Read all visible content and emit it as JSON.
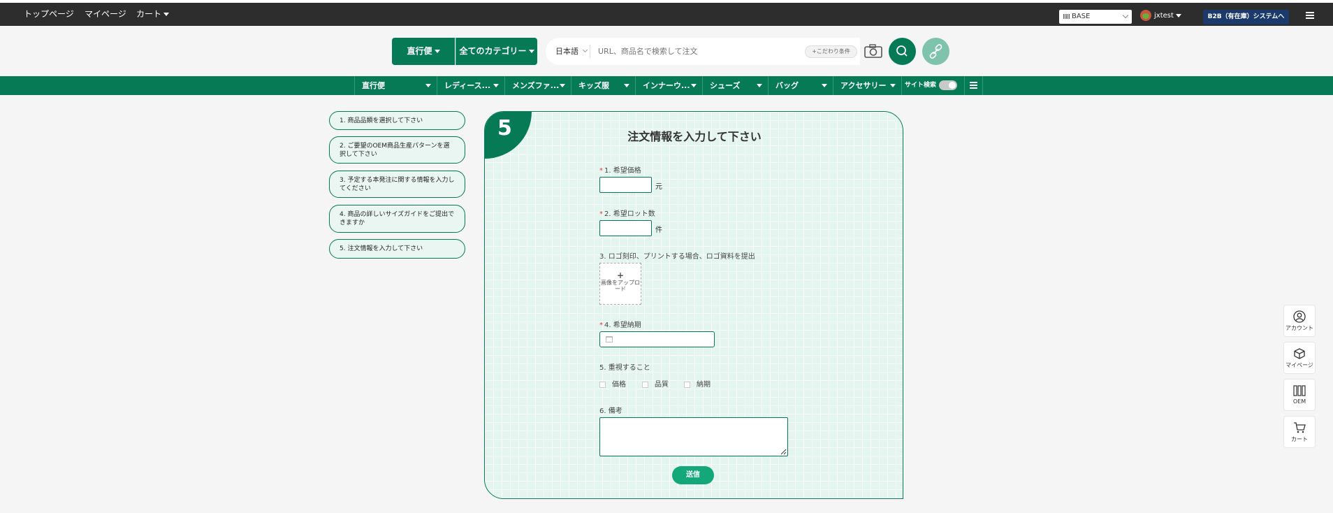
{
  "topbar": {
    "nav_home": "トップページ",
    "nav_mypage": "マイページ",
    "nav_cart": "カート",
    "base_select": "BASE",
    "username": "jxtest",
    "b2b_button": "B2B（有在庫）システムへ"
  },
  "search": {
    "shipping_button": "直行便",
    "category_button": "全てのカテゴリー",
    "language": "日本語",
    "placeholder": "URL、商品名で検索して注文",
    "conditions_button": "+こだわり条件"
  },
  "categories": [
    "直行便",
    "レディース...",
    "メンズファ...",
    "キッズ服",
    "インナーウ...",
    "シューズ",
    "バッグ",
    "アクセサリー",
    "サイト検索"
  ],
  "steps": [
    "1. 商品品類を選択して下さい",
    "2. ご要望のOEM商品生産パターンを選択して下さい",
    "3. 予定する本発注に関する情報を入力してください",
    "4. 商品の詳しいサイズガイドをご提出できますか",
    "5. 注文情報を入力して下さい"
  ],
  "form": {
    "step_number": "5",
    "title": "注文情報を入力して下さい",
    "required_mark": "*",
    "field1_label": "1. 希望価格",
    "field1_unit": "元",
    "field2_label": "2. 希望ロット数",
    "field2_unit": "件",
    "field3_label": "3. ロゴ刻印、プリントする場合、ロゴ資料を提出",
    "upload_plus": "+",
    "upload_text": "画像をアップロード",
    "field4_label": "4. 希望納期",
    "field5_label": "5. 重視すること",
    "options": [
      "価格",
      "品質",
      "納期"
    ],
    "field6_label": "6. 備考",
    "submit": "送信"
  },
  "side_buttons": [
    "アカウント",
    "マイページ",
    "OEM",
    "カート"
  ],
  "colors": {
    "brand_green": "#057a55",
    "topbar_bg": "#2d2d2d",
    "b2b_button_bg": "#1b3a6b",
    "required_red": "#e4393c"
  }
}
